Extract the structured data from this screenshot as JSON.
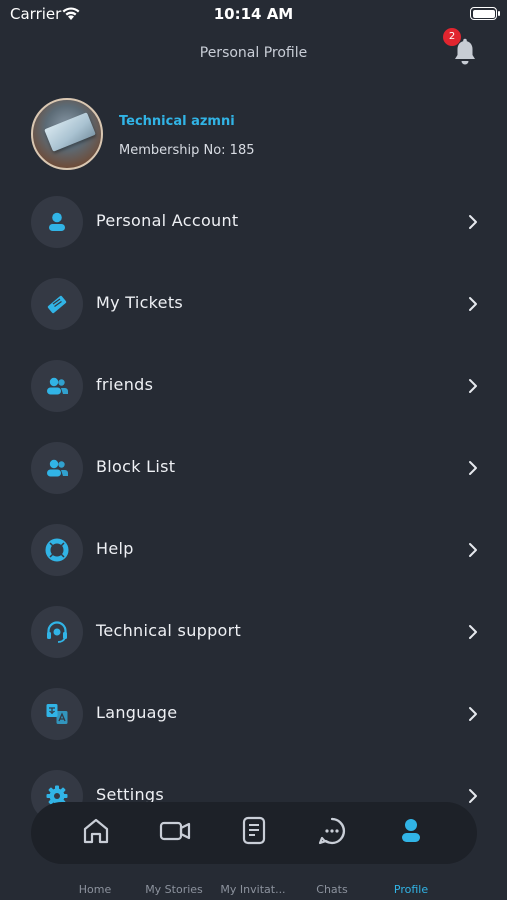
{
  "status_bar": {
    "carrier": "Carrier",
    "time": "10:14 AM"
  },
  "header": {
    "title": "Personal Profile",
    "notification_count": "2"
  },
  "profile": {
    "name": "Technical azmni",
    "membership": "Membership No: 185"
  },
  "menu": [
    {
      "label": "Personal Account",
      "icon": "user-icon"
    },
    {
      "label": "My Tickets",
      "icon": "tickets-icon"
    },
    {
      "label": "friends",
      "icon": "friends-icon"
    },
    {
      "label": "Block List",
      "icon": "block-list-icon"
    },
    {
      "label": "Help",
      "icon": "lifebuoy-icon"
    },
    {
      "label": "Technical support",
      "icon": "headset-icon"
    },
    {
      "label": "Language",
      "icon": "translate-icon"
    },
    {
      "label": "Settings",
      "icon": "gear-icon"
    }
  ],
  "bottom_nav": [
    {
      "label": "Home",
      "icon": "home-icon"
    },
    {
      "label": "My Stories",
      "icon": "video-icon"
    },
    {
      "label": "My Invitat...",
      "icon": "document-icon"
    },
    {
      "label": "Chats",
      "icon": "chat-icon"
    },
    {
      "label": "Profile",
      "icon": "profile-icon",
      "active": true
    }
  ],
  "colors": {
    "background": "#262b34",
    "accent": "#31b4e6",
    "icon_bg": "#343944",
    "nav_bg": "#1d2128",
    "badge": "#e1252f"
  }
}
